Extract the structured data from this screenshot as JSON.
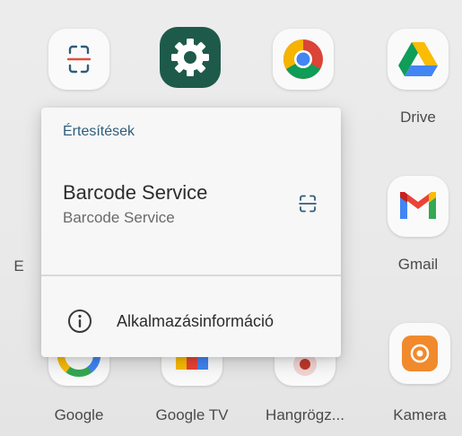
{
  "apps": {
    "drive_label": "Drive",
    "gmail_label": "Gmail",
    "google_label": "Google",
    "googletv_label": "Google TV",
    "hangrogz_label": "Hangrögz...",
    "kamera_label": "Kamera",
    "hidden_left_label_fragment": "E"
  },
  "popup": {
    "header": "Értesítések",
    "notification_title": "Barcode Service",
    "notification_subtitle": "Barcode Service",
    "app_info_label": "Alkalmazásinformáció"
  },
  "icons": {
    "barcode": "barcode-scan-icon",
    "settings": "gear-icon",
    "chrome": "chrome-icon",
    "drive": "drive-icon",
    "gmail": "gmail-icon",
    "google": "google-icon",
    "googletv": "google-tv-icon",
    "recorder": "recorder-icon",
    "camera": "camera-icon",
    "info": "info-icon"
  },
  "colors": {
    "popup_header": "#2f5d7a",
    "settings_bg": "#1e5a4a",
    "kamera_bg": "#f08a2c"
  }
}
